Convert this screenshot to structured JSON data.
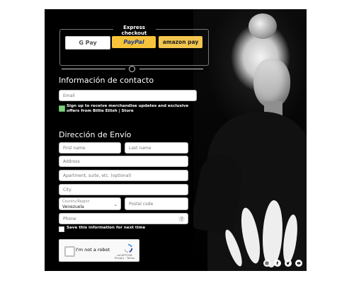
{
  "express_checkout": {
    "title": "Express checkout",
    "buttons": [
      {
        "name": "google-pay",
        "label": "G Pay"
      },
      {
        "name": "paypal",
        "label": "PayPal"
      },
      {
        "name": "amazon-pay",
        "label": "amazon pay"
      }
    ]
  },
  "contact": {
    "title": "Información de contacto",
    "email_placeholder": "Email",
    "subscribe_text": "Sign up to receive merchandise updates and exclusive offers from Billie Eilish | Store",
    "subscribe_checked": true
  },
  "shipping": {
    "title": "Dirección de Envío",
    "first_name_placeholder": "First name",
    "last_name_placeholder": "Last name",
    "address_placeholder": "Address",
    "apartment_placeholder": "Apartment, suite, etc. (optional)",
    "city_placeholder": "City",
    "country_label": "Country/Region",
    "country_value": "Venezuela",
    "postal_placeholder": "Postal code",
    "phone_placeholder": "Phone",
    "save_info_label": "Save this information for next time"
  },
  "recaptcha": {
    "checkbox_text": "I'm not a robot",
    "brand": "reCAPTCHA",
    "links": "Privacy - Terms"
  },
  "social": [
    "instagram-icon",
    "facebook-icon",
    "twitter-icon",
    "youtube-icon"
  ]
}
